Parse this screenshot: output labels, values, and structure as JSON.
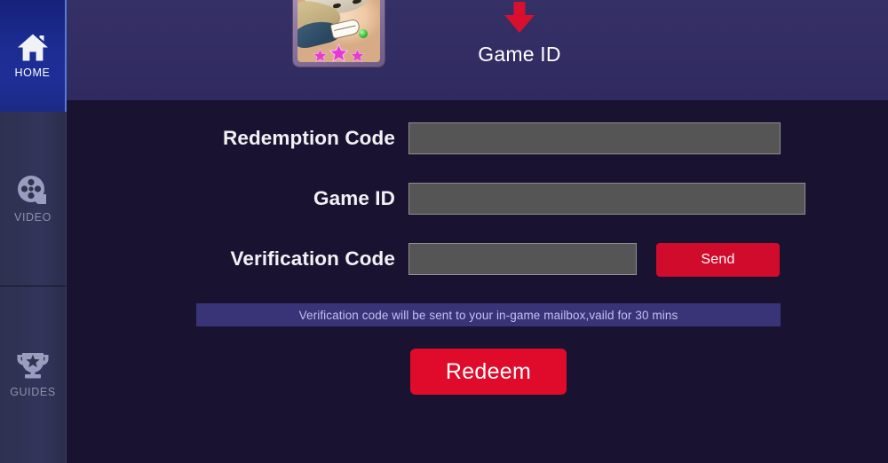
{
  "sidebar": {
    "items": [
      {
        "id": "home",
        "label": "HOME",
        "icon": "home-icon",
        "active": true
      },
      {
        "id": "video",
        "label": "VIDEO",
        "icon": "video-reel-icon",
        "active": false
      },
      {
        "id": "guides",
        "label": "GUIDES",
        "icon": "trophy-icon",
        "active": false
      }
    ]
  },
  "header": {
    "avatar": {
      "icon": "character-avatar",
      "star_count": 3,
      "star_color": "#e040c8",
      "frame_color": "#a88fb8"
    },
    "pointer": {
      "icon": "arrow-down-icon",
      "color": "#d8102e"
    },
    "label": "Game ID"
  },
  "form": {
    "fields": [
      {
        "id": "redemption-code",
        "label": "Redemption Code",
        "value": "",
        "placeholder": ""
      },
      {
        "id": "game-id",
        "label": "Game ID",
        "value": "",
        "placeholder": ""
      },
      {
        "id": "verification-code",
        "label": "Verification Code",
        "value": "",
        "placeholder": ""
      }
    ],
    "send_label": "Send",
    "notice": "Verification code will be sent to your in-game mailbox,vaild for 30 mins",
    "redeem_label": "Redeem"
  },
  "colors": {
    "accent_red": "#d90b2b",
    "header_bg": "#322d63",
    "page_bg": "#191331",
    "sidebar_active": "#1c2c92",
    "notice_bg": "#393377",
    "input_bg": "#555555"
  }
}
